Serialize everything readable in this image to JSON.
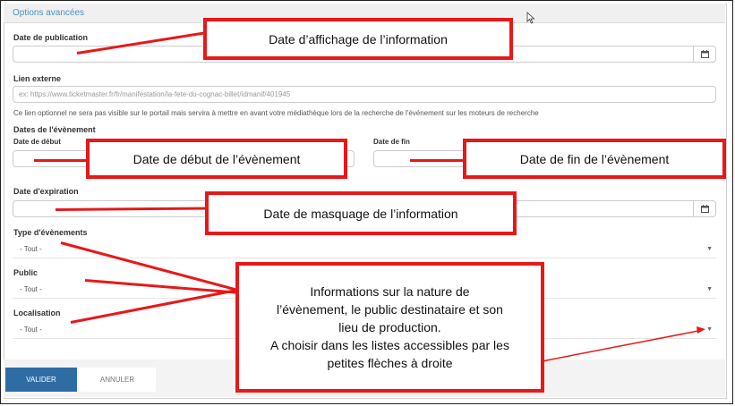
{
  "header": {
    "title": "Options avancées"
  },
  "fields": {
    "publication_label": "Date de publication",
    "lien_label": "Lien externe",
    "lien_placeholder": "ex: https://www.ticketmaster.fr/fr/manifestation/la-fete-du-cognac-billet/idmanif/401945",
    "lien_help": "Ce lien optionnel ne sera pas visible sur le portail mais servira à mettre en avant votre médiathèque lors de la recherche de l'événement sur les moteurs de recherche",
    "dates_label": "Dates de l'évènement",
    "debut_label": "Date de début",
    "fin_label": "Date de fin",
    "expiration_label": "Date d'expiration",
    "type_label": "Type d'évènements",
    "type_value": "- Tout -",
    "public_label": "Public",
    "public_value": "- Tout -",
    "localisation_label": "Localisation",
    "localisation_value": "- Tout -"
  },
  "buttons": {
    "valider": "VALIDER",
    "annuler": "ANNULER"
  },
  "callouts": {
    "affichage": "Date d’affichage de l’information",
    "debut": "Date de début de l’évènement",
    "fin": "Date de fin de l’évènement",
    "masquage": "Date de masquage de l’information",
    "nature_line1": "Informations sur la nature de",
    "nature_line2": "l’évènement, le public destinataire et son",
    "nature_line3": "lieu de production.",
    "nature_line4": "A choisir dans les listes accessibles par les",
    "nature_line5": "petites flèches à droite"
  },
  "colors": {
    "accent": "#e81818",
    "primary_button": "#2e6da4",
    "header_link": "#4a90c7"
  },
  "icons": [
    "calendar-icon",
    "cursor-icon",
    "caret-down-icon"
  ]
}
